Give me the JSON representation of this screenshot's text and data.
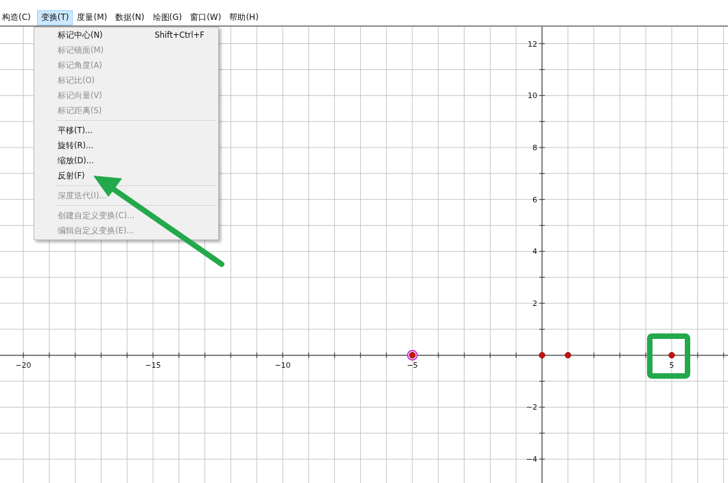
{
  "menu_bar": [
    {
      "label": "构造(C)",
      "selected": false
    },
    {
      "label": "变换(T)",
      "selected": true
    },
    {
      "label": "度量(M)",
      "selected": false
    },
    {
      "label": "数据(N)",
      "selected": false
    },
    {
      "label": "绘图(G)",
      "selected": false
    },
    {
      "label": "窗口(W)",
      "selected": false
    },
    {
      "label": "帮助(H)",
      "selected": false
    }
  ],
  "dropdown": [
    {
      "kind": "item",
      "label": "标记中心(N)",
      "shortcut": "Shift+Ctrl+F",
      "disabled": false
    },
    {
      "kind": "item",
      "label": "标记镜面(M)",
      "disabled": true
    },
    {
      "kind": "item",
      "label": "标记角度(A)",
      "disabled": true
    },
    {
      "kind": "item",
      "label": "标记比(O)",
      "disabled": true
    },
    {
      "kind": "item",
      "label": "标记向量(V)",
      "disabled": true
    },
    {
      "kind": "item",
      "label": "标记距离(S)",
      "disabled": true
    },
    {
      "kind": "separator"
    },
    {
      "kind": "item",
      "label": "平移(T)...",
      "disabled": false
    },
    {
      "kind": "item",
      "label": "旋转(R)...",
      "disabled": false
    },
    {
      "kind": "item",
      "label": "缩放(D)...",
      "disabled": false
    },
    {
      "kind": "item",
      "label": "反射(F)",
      "disabled": false
    },
    {
      "kind": "separator"
    },
    {
      "kind": "item",
      "label": "深度迭代(I)...",
      "disabled": true
    },
    {
      "kind": "separator"
    },
    {
      "kind": "item",
      "label": "创建自定义变换(C)...",
      "disabled": true
    },
    {
      "kind": "item",
      "label": "编辑自定义变换(E)...",
      "disabled": true
    }
  ],
  "graph": {
    "chart_data": {
      "type": "scatter",
      "x": [
        -5,
        0,
        1,
        5
      ],
      "series": [
        {
          "color": "#cc1111",
          "values": [
            0,
            0,
            0,
            0
          ]
        }
      ],
      "grid": true,
      "xlim": [
        -20.9,
        7.17
      ],
      "ylim": [
        -4.92,
        12.65
      ],
      "xticks": [
        {
          "value": -20,
          "label": "−20"
        },
        {
          "value": -15,
          "label": "−15"
        },
        {
          "value": -10,
          "label": "−10"
        },
        {
          "value": -5,
          "label": "−5"
        },
        {
          "value": 5,
          "label": "5"
        }
      ],
      "yticks": [
        {
          "value": 12,
          "label": "12"
        },
        {
          "value": 10,
          "label": "10"
        },
        {
          "value": 8,
          "label": "8"
        },
        {
          "value": 6,
          "label": "6"
        },
        {
          "value": 4,
          "label": "4"
        },
        {
          "value": 2,
          "label": "2"
        },
        {
          "value": -2,
          "label": "−2"
        },
        {
          "value": -4,
          "label": "−4"
        }
      ]
    },
    "point_states": [
      {
        "selected": true
      },
      {
        "selected": false
      },
      {
        "selected": false
      },
      {
        "selected": false
      }
    ]
  }
}
